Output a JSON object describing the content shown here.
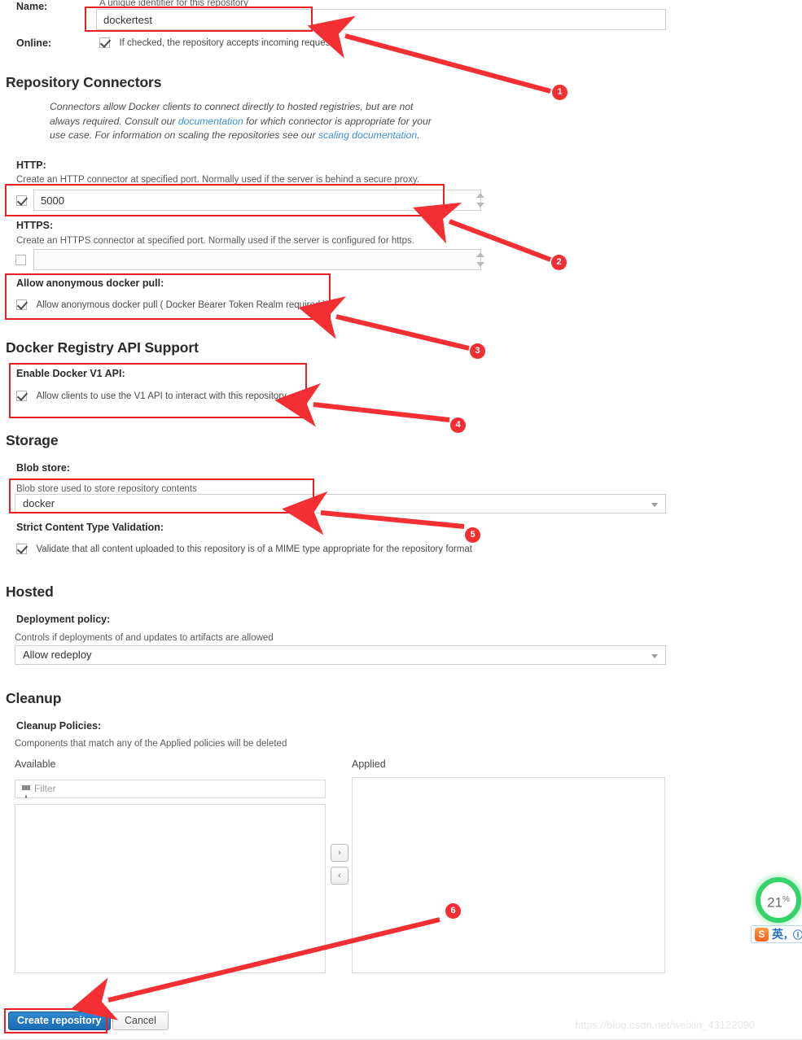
{
  "form": {
    "name": {
      "label": "Name:",
      "helper": "A unique identifier for this repository",
      "value": "dockertest"
    },
    "online": {
      "label": "Online:",
      "checkbox_text": "If checked, the repository accepts incoming requests",
      "checked": true
    }
  },
  "connectors": {
    "heading": "Repository Connectors",
    "description_part1": "Connectors allow Docker clients to connect directly to hosted registries, but are not always required. Consult our ",
    "link1": "documentation",
    "description_part2": " for which connector is appropriate for your use case. For information on scaling the repositories see our ",
    "link2": "scaling documentation",
    "description_part3": ".",
    "http": {
      "label": "HTTP:",
      "helper": "Create an HTTP connector at specified port. Normally used if the server is behind a secure proxy.",
      "value": "5000",
      "checked": true
    },
    "https": {
      "label": "HTTPS:",
      "helper": "Create an HTTPS connector at specified port. Normally used if the server is configured for https.",
      "value": "",
      "checked": false
    },
    "anonymous": {
      "label": "Allow anonymous docker pull:",
      "checkbox_text": "Allow anonymous docker pull ( Docker Bearer Token Realm required )",
      "checked": true
    }
  },
  "api_support": {
    "heading": "Docker Registry API Support",
    "v1": {
      "label": "Enable Docker V1 API:",
      "checkbox_text": "Allow clients to use the V1 API to interact with this repository",
      "checked": true
    }
  },
  "storage": {
    "heading": "Storage",
    "blob_store": {
      "label": "Blob store:",
      "helper": "Blob store used to store repository contents",
      "value": "docker"
    },
    "strict": {
      "label": "Strict Content Type Validation:",
      "checkbox_text": "Validate that all content uploaded to this repository is of a MIME type appropriate for the repository format",
      "checked": true
    }
  },
  "hosted": {
    "heading": "Hosted",
    "deployment_policy": {
      "label": "Deployment policy:",
      "helper": "Controls if deployments of and updates to artifacts are allowed",
      "value": "Allow redeploy"
    }
  },
  "cleanup": {
    "heading": "Cleanup",
    "policies": {
      "label": "Cleanup Policies:",
      "helper": "Components that match any of the Applied policies will be deleted",
      "available_label": "Available",
      "applied_label": "Applied",
      "filter_placeholder": "Filter",
      "filter_value": "",
      "available_items": [],
      "applied_items": [],
      "move_right_label": "›",
      "move_left_label": "‹"
    }
  },
  "actions": {
    "create_label": "Create repository",
    "cancel_label": "Cancel"
  },
  "annotations": {
    "markers": [
      "1",
      "2",
      "3",
      "4",
      "5",
      "6"
    ],
    "accent_color": "#f42f33"
  },
  "watermark": {
    "text": "https://blog.csdn.net/weixin_43122090"
  },
  "sogou_widget": {
    "percent": "21",
    "percent_suffix": "%",
    "logo_label": "S",
    "mode_label": "英",
    "punct_label": "，",
    "menu_label": "ⓘ"
  }
}
